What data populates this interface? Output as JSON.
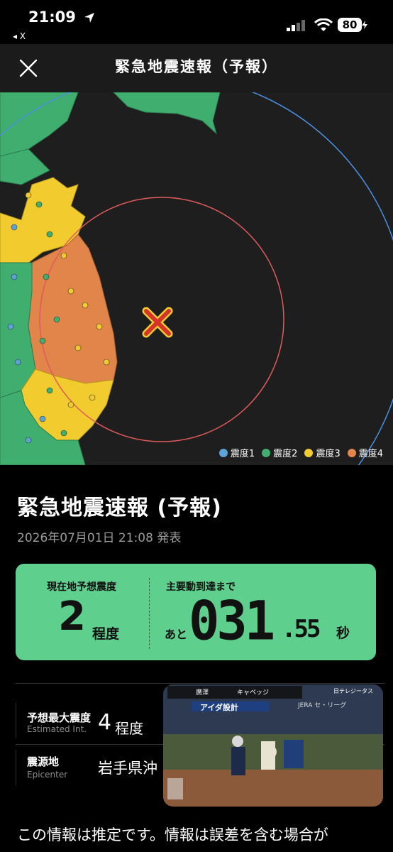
{
  "status_bar": {
    "time": "21:09",
    "back_app": "◂ X",
    "battery": "80"
  },
  "header": {
    "title": "緊急地震速報（予報）"
  },
  "map": {
    "legend": [
      {
        "label": "震度1",
        "color": "#5ba3d9"
      },
      {
        "label": "震度2",
        "color": "#3fae6e"
      },
      {
        "label": "震度3",
        "color": "#f2cc2e"
      },
      {
        "label": "震度4",
        "color": "#e2854a"
      }
    ]
  },
  "report": {
    "title": "緊急地震速報 (予報)",
    "issued": "2026年07月01日 21:08 発表"
  },
  "card": {
    "current_label": "現在地予想震度",
    "current_value": "2",
    "current_unit": "程度",
    "arrival_label": "主要動到達まで",
    "arrival_prefix": "あと",
    "arrival_big": "031",
    "arrival_small": ".55",
    "arrival_unit": "秒"
  },
  "details": {
    "max_int_label": "予想最大震度",
    "max_int_label_en": "Estimated Int.",
    "max_int_value": "4",
    "max_int_unit": "程度",
    "epicenter_label": "震源地",
    "epicenter_label_en": "Epicenter",
    "epicenter_value": "岩手県沖"
  },
  "notice": "この情報は推定です。情報は誤差を含む場合が",
  "video": {
    "scoreboard": {
      "batter": "廣澤",
      "pitcher": "キャベッジ",
      "tv": "日テレジータス"
    },
    "banner": "アイダ設計",
    "banner2": "JERA セ・リーグ"
  }
}
